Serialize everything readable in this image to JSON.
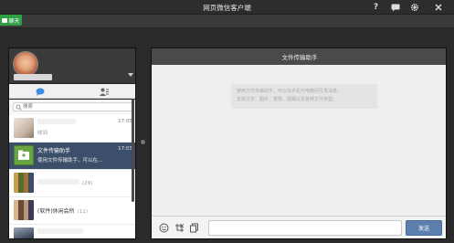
{
  "window": {
    "title": "网页微信客户端"
  },
  "tabbar": {
    "chat_tab_label": "聊天"
  },
  "search": {
    "placeholder": "搜索"
  },
  "conversations": [
    {
      "name": "",
      "time": "17:05",
      "message": "收到",
      "count": ""
    },
    {
      "name": "文件传输助手",
      "time": "17:03",
      "message": "使用文件传输助手，可以在...",
      "count": ""
    },
    {
      "name": "",
      "time": "",
      "message": "",
      "count": "(29)"
    },
    {
      "name": "(软件)休闲会所",
      "time": "",
      "message": "",
      "count": "(11)"
    },
    {
      "name": "",
      "time": "",
      "message": "",
      "count": ""
    }
  ],
  "chat": {
    "title": "文件传输助手",
    "notice_line1": "使用文件传输助手，可以在手机与电脑间互发消息。",
    "notice_line2": "支持文字、图片、表情、视频以及各种文件类型。",
    "send_label": "发送"
  },
  "colors": {
    "accent_green": "#2ea043",
    "selected_row": "#3c4f6a",
    "send_button": "#5d7fb0"
  },
  "icons": [
    "help-icon",
    "chat-bubble-icon",
    "gear-icon",
    "close-icon",
    "chat-tab-icon",
    "contacts-icon",
    "search-icon",
    "emoji-icon",
    "screenshot-icon",
    "copy-icon"
  ]
}
